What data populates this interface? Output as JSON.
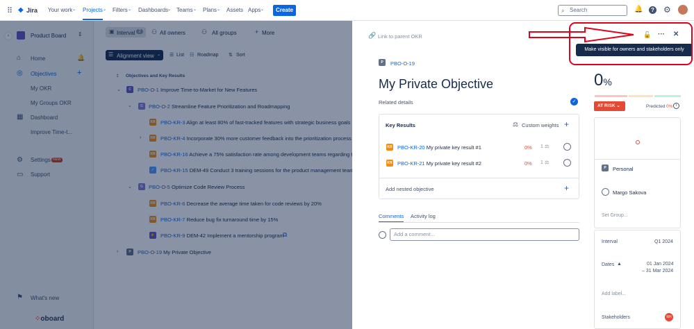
{
  "topnav": {
    "app_name": "Jira",
    "items": [
      "Your work",
      "Projects",
      "Filters",
      "Dashboards",
      "Teams",
      "Plans",
      "Assets",
      "Apps"
    ],
    "create_label": "Create",
    "search_placeholder": "Search"
  },
  "sidebar": {
    "project_name": "Product Board",
    "items": {
      "home": "Home",
      "objectives": "Objectives",
      "my_okr": "My OKR",
      "my_groups_okr": "My Groups OKR",
      "dashboard": "Dashboard",
      "improve": "Improve Time-t...",
      "settings": "Settings",
      "settings_badge": "NEW",
      "support": "Support",
      "whats_new": "What's new"
    },
    "brand": "oboard"
  },
  "main": {
    "interval_label": "Interval",
    "interval_count": "2",
    "all_owners": "All owners",
    "all_groups": "All groups",
    "more": "More",
    "alignment_view": "Alignment view",
    "list": "List",
    "roadmap": "Roadmap",
    "sort": "Sort",
    "col_header": "Objectives and Key Results",
    "rows": [
      {
        "key": "PBO-O-1",
        "title": "Improve Time-to-Market for New Features",
        "badge": "C"
      },
      {
        "key": "PBO-O-2",
        "title": "Streamline Feature Prioritization and Roadmapping",
        "badge": "G"
      },
      {
        "key": "PBO-KR-3",
        "title": "Align at least 80% of fast-tracked features with strategic business goals",
        "badge": "KR"
      },
      {
        "key": "PBO-KR-4",
        "title": "Incorporate 30% more customer feedback into the prioritization process",
        "badge": "KR"
      },
      {
        "key": "PBO-KR-16",
        "title": "Achieve a 75% satisfaction rate among development teams regarding the",
        "badge": "KR"
      },
      {
        "key": "PBO-KR-15",
        "title": "DEM-49 Conduct 3 training sessions for the product management team to",
        "badge": ""
      },
      {
        "key": "PBO-O-5",
        "title": "Optimize Code Review Process",
        "badge": "G"
      },
      {
        "key": "PBO-KR-6",
        "title": "Decrease the average time taken for code reviews by 20%",
        "badge": "KR"
      },
      {
        "key": "PBO-KR-7",
        "title": "Reduce bug fix turnaround time by 15%",
        "badge": "KR"
      },
      {
        "key": "PBO-KR-9",
        "title": "DEM-42 Implement a mentorship program",
        "badge": ""
      },
      {
        "key": "PBO-O-19",
        "title": "My Private Objective",
        "badge": "P"
      }
    ]
  },
  "panel": {
    "link_parent": "Link to parent OKR",
    "tooltip": "Make visible for owners and stakeholders only",
    "key": "PBO-O-19",
    "key_badge": "P",
    "title": "My Private Objective",
    "related_details": "Related details",
    "key_results_label": "Key Results",
    "custom_weights": "Custom weights",
    "krs": [
      {
        "key": "PBO-KR-20",
        "title": "My private key result #1",
        "progress": "0%",
        "weight": "1",
        "badge": "KR"
      },
      {
        "key": "PBO-KR-21",
        "title": "My private key result #2",
        "progress": "0%",
        "weight": "1",
        "badge": "KR"
      }
    ],
    "add_nested": "Add nested objective",
    "tabs": [
      "Comments",
      "Activity log"
    ],
    "comment_placeholder": "Add a comment...",
    "progress_value": "0",
    "progress_unit": "%",
    "status": "AT RISK",
    "predicted_label": "Predicted",
    "predicted_value": "0%",
    "group_badge": "P",
    "group": "Personal",
    "owner": "Margo Sakova",
    "set_group": "Set Group...",
    "interval_label": "Interval",
    "interval_value": "Q1 2024",
    "dates_label": "Dates",
    "date_start": "01 Jan 2024",
    "date_end": "– 31 Mar 2024",
    "add_label": "Add label...",
    "stakeholders_label": "Stakeholders",
    "stakeholder_initials": "RH"
  },
  "colors": {
    "accent": "#0c66e4",
    "annotation": "#e3001b",
    "at_risk": "#e34935"
  }
}
